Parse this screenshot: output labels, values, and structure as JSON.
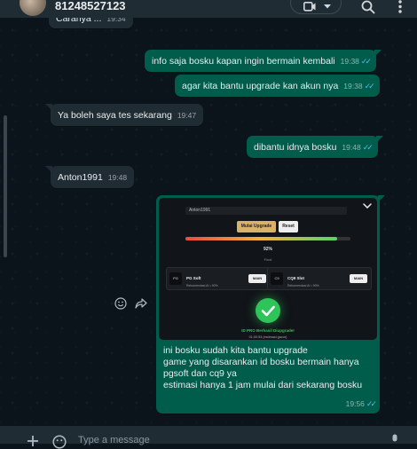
{
  "header": {
    "contact_name": "81248527123"
  },
  "messages": [
    {
      "text": "Caranya ...",
      "time": "19:34",
      "direction": "in"
    },
    {
      "text": "info saja bosku kapan ingin bermain kembali",
      "time": "19:38",
      "direction": "out"
    },
    {
      "text": "agar kita bantu upgrade kan akun nya",
      "time": "19:38",
      "direction": "out"
    },
    {
      "text": "Ya boleh saya tes sekarang",
      "time": "19:47",
      "direction": "in"
    },
    {
      "text": "dibantu idnya bosku",
      "time": "19:48",
      "direction": "out"
    },
    {
      "text": "Anton1991",
      "time": "19:48",
      "direction": "in"
    },
    {
      "direction": "out",
      "time": "19:56",
      "caption_lines": [
        "ini bosku sudah kita bantu upgrade",
        "game yang disarankan id bosku bermain hanya",
        "pgsoft dan cq9 ya",
        "estimasi hanya 1 jam mulai dari sekarang bosku"
      ],
      "image": {
        "username": "Anton1991",
        "upgrade_button": "Mulai Upgrade",
        "reset_button": "Reset",
        "progress_percent": 92,
        "progress_label": "92%",
        "status": "Final",
        "cards": [
          {
            "icon": "PG",
            "name": "PG Soft",
            "sub": "Rekomendasi AI • 90%",
            "button": "MAIN"
          },
          {
            "icon": "C9",
            "name": "CQ9 Slot",
            "sub": "Rekomendasi AI • 90%",
            "button": "MAIN"
          }
        ],
        "success_title": "ID PRO Berhasil Diupgrade!",
        "success_sub": "01:00:53 (estimasi gacor)"
      }
    }
  ],
  "footer": {
    "placeholder": "Type a message"
  },
  "colors": {
    "outgoing": "#005c4b",
    "incoming": "#202c33",
    "background": "#0b141a",
    "read_ticks": "#53bdeb"
  }
}
